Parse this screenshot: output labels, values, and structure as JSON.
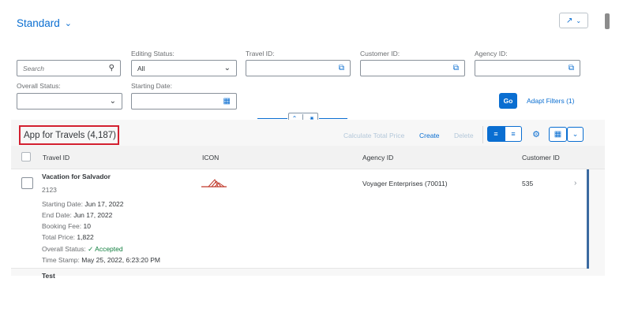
{
  "header": {
    "variant_label": "Standard",
    "share_icon": "share-icon"
  },
  "filters": {
    "search_placeholder": "Search",
    "editing_status": {
      "label": "Editing Status:",
      "value": "All"
    },
    "travel_id": {
      "label": "Travel ID:",
      "value": ""
    },
    "customer_id": {
      "label": "Customer ID:",
      "value": ""
    },
    "agency_id": {
      "label": "Agency ID:",
      "value": ""
    },
    "overall_status": {
      "label": "Overall Status:",
      "value": ""
    },
    "starting_date": {
      "label": "Starting Date:",
      "value": ""
    },
    "go_label": "Go",
    "adapt_label": "Adapt Filters (1)"
  },
  "table": {
    "title": "App for Travels (4,187)",
    "toolbar": {
      "calculate_label": "Calculate Total Price",
      "create_label": "Create",
      "delete_label": "Delete"
    },
    "columns": [
      "Travel ID",
      "ICON",
      "Agency ID",
      "Customer ID"
    ],
    "rows": [
      {
        "title": "Vacation for Salvador",
        "id": "2123",
        "attributes": [
          {
            "label": "Starting Date:",
            "value": "Jun 17, 2022"
          },
          {
            "label": "End Date:",
            "value": "Jun 17, 2022"
          },
          {
            "label": "Booking Fee:",
            "value": "10"
          },
          {
            "label": "Total Price:",
            "value": "1,822"
          },
          {
            "label": "Overall Status:",
            "value": "Accepted"
          },
          {
            "label": "Time Stamp:",
            "value": "May 25, 2022, 6:23:20 PM"
          }
        ],
        "agency": "Voyager Enterprises (70011)",
        "customer": "535"
      },
      {
        "title": "Test"
      }
    ]
  },
  "colors": {
    "accent": "#0a6ed1",
    "highlight_border": "#d32030",
    "accepted": "#107e3e"
  }
}
